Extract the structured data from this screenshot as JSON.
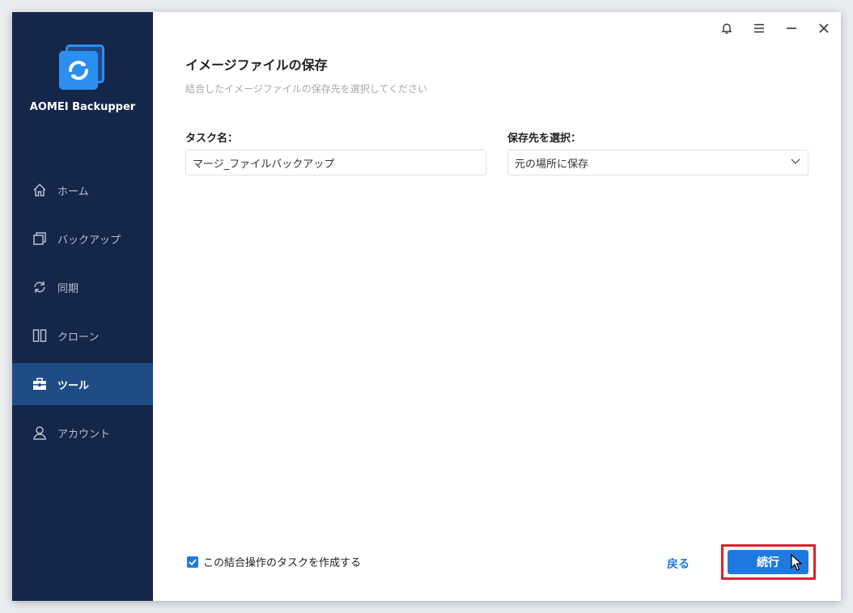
{
  "app": {
    "name": "AOMEI Backupper"
  },
  "sidebar": {
    "items": [
      {
        "label": "ホーム",
        "icon": "home-icon"
      },
      {
        "label": "バックアップ",
        "icon": "backup-icon"
      },
      {
        "label": "同期",
        "icon": "sync-icon"
      },
      {
        "label": "クローン",
        "icon": "clone-icon"
      },
      {
        "label": "ツール",
        "icon": "tools-icon",
        "active": true
      },
      {
        "label": "アカウント",
        "icon": "account-icon"
      }
    ]
  },
  "titlebar": {
    "icons": [
      "bell-icon",
      "menu-icon",
      "minimize-icon",
      "close-icon"
    ]
  },
  "main": {
    "title": "イメージファイルの保存",
    "subtitle": "結合したイメージファイルの保存先を選択してください",
    "task_name_label": "タスク名：",
    "task_name_value": "マージ_ファイルバックアップ",
    "destination_label": "保存先を選択：",
    "destination_value": "元の場所に保存",
    "checkbox_label": "この結合操作のタスクを作成する",
    "checkbox_checked": true,
    "back_label": "戻る",
    "continue_label": "続行"
  },
  "colors": {
    "sidebar_bg": "#14264a",
    "sidebar_active": "#1f4c86",
    "accent": "#1e7ae0",
    "highlight": "#e0202b"
  }
}
